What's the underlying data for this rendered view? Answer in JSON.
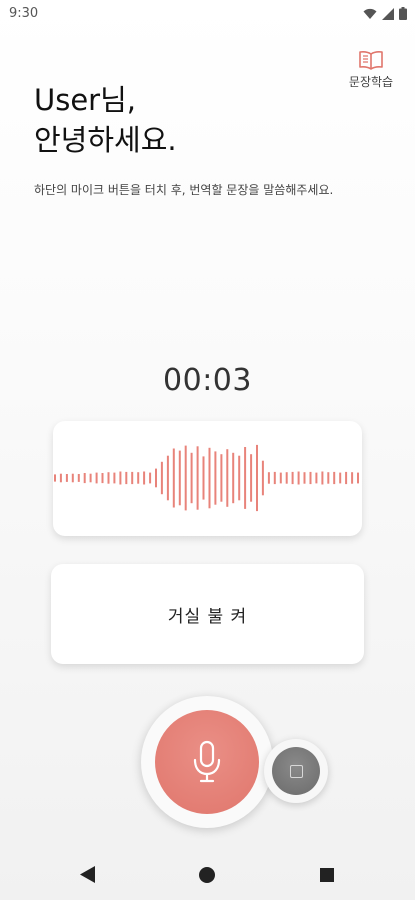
{
  "status_bar": {
    "time": "9:30"
  },
  "header": {
    "learn_label": "문장학습"
  },
  "greeting": {
    "line1": "User님,",
    "line2": "안녕하세요."
  },
  "instruction": "하단의 마이크 버튼을 터치 후, 번역할 문장을 말씀해주세요.",
  "timer": "00:03",
  "recognized_text": "거실 불 켜",
  "waveform": {
    "color": "#e8837a",
    "levels": [
      0.1,
      0.12,
      0.11,
      0.12,
      0.11,
      0.14,
      0.12,
      0.15,
      0.14,
      0.16,
      0.15,
      0.18,
      0.17,
      0.17,
      0.16,
      0.18,
      0.15,
      0.26,
      0.45,
      0.62,
      0.82,
      0.76,
      0.9,
      0.7,
      0.88,
      0.6,
      0.84,
      0.74,
      0.66,
      0.8,
      0.7,
      0.62,
      0.86,
      0.66,
      0.92,
      0.48,
      0.16,
      0.17,
      0.15,
      0.16,
      0.17,
      0.18,
      0.16,
      0.17,
      0.15,
      0.18,
      0.16,
      0.17,
      0.15,
      0.17,
      0.16,
      0.15
    ]
  },
  "colors": {
    "accent": "#e0766c",
    "stop": "#6f6f6f",
    "text": "#222222"
  },
  "icons": {
    "learn": "open-book-icon",
    "mic": "microphone-icon",
    "stop": "stop-icon",
    "back": "nav-back-icon",
    "home": "nav-home-icon",
    "recent": "nav-recents-icon"
  }
}
